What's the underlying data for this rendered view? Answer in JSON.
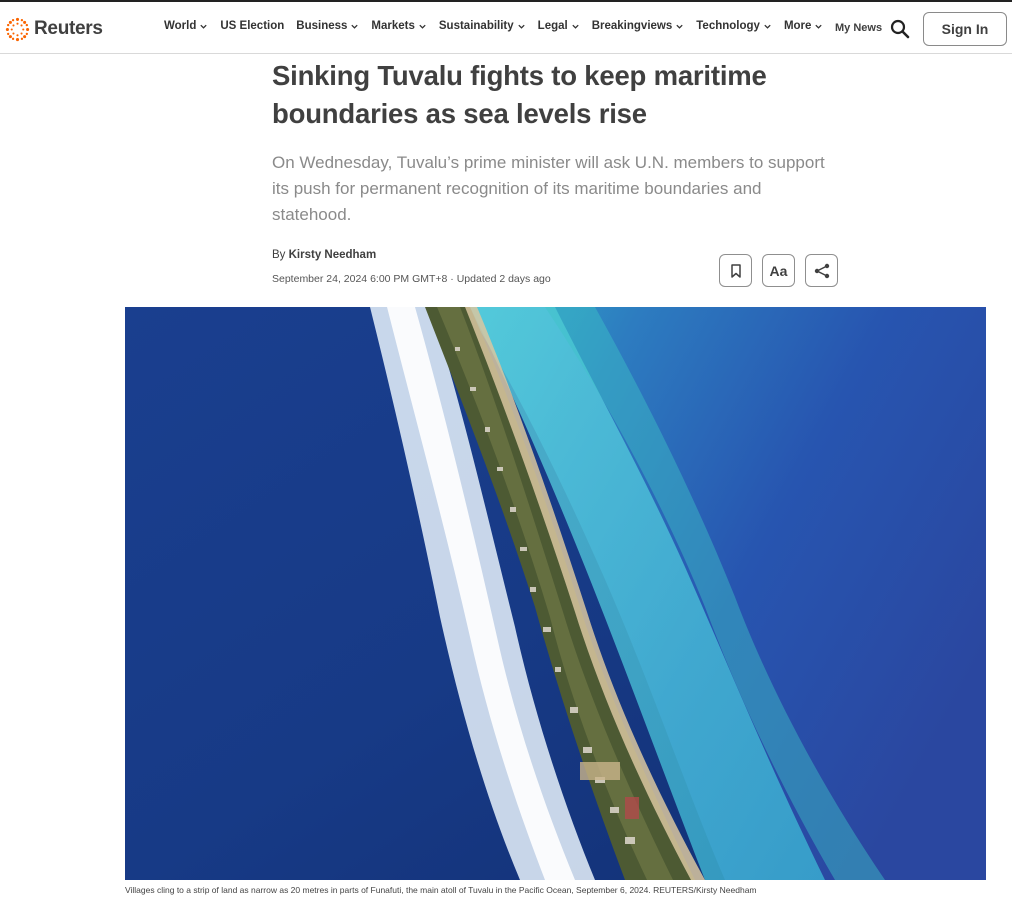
{
  "header": {
    "brand": "Reuters",
    "nav": [
      {
        "label": "World",
        "dropdown": true
      },
      {
        "label": "US Election",
        "dropdown": false
      },
      {
        "label": "Business",
        "dropdown": true
      },
      {
        "label": "Markets",
        "dropdown": true
      },
      {
        "label": "Sustainability",
        "dropdown": true
      },
      {
        "label": "Legal",
        "dropdown": true
      },
      {
        "label": "Breakingviews",
        "dropdown": true
      },
      {
        "label": "Technology",
        "dropdown": true
      },
      {
        "label": "More",
        "dropdown": true
      }
    ],
    "my_news": "My News",
    "sign_in": "Sign In",
    "brand_color": "#fa6400"
  },
  "article": {
    "headline": "Sinking Tuvalu fights to keep maritime boundaries as sea levels rise",
    "dek": "On Wednesday, Tuvalu’s prime minister will ask U.N. members to support its push for permanent recognition of its maritime boundaries and statehood.",
    "byline_prefix": "By",
    "author": "Kirsty Needham",
    "dateline": "September 24, 2024 6:00 PM GMT+8 · Updated 2 days ago",
    "tools": {
      "text_size_label": "Aa"
    },
    "photo_caption": "Villages cling to a strip of land as narrow as 20 metres in parts of Funafuti, the main atoll of Tuvalu in the Pacific Ocean, September 6, 2024. REUTERS/Kirsty Needham"
  }
}
